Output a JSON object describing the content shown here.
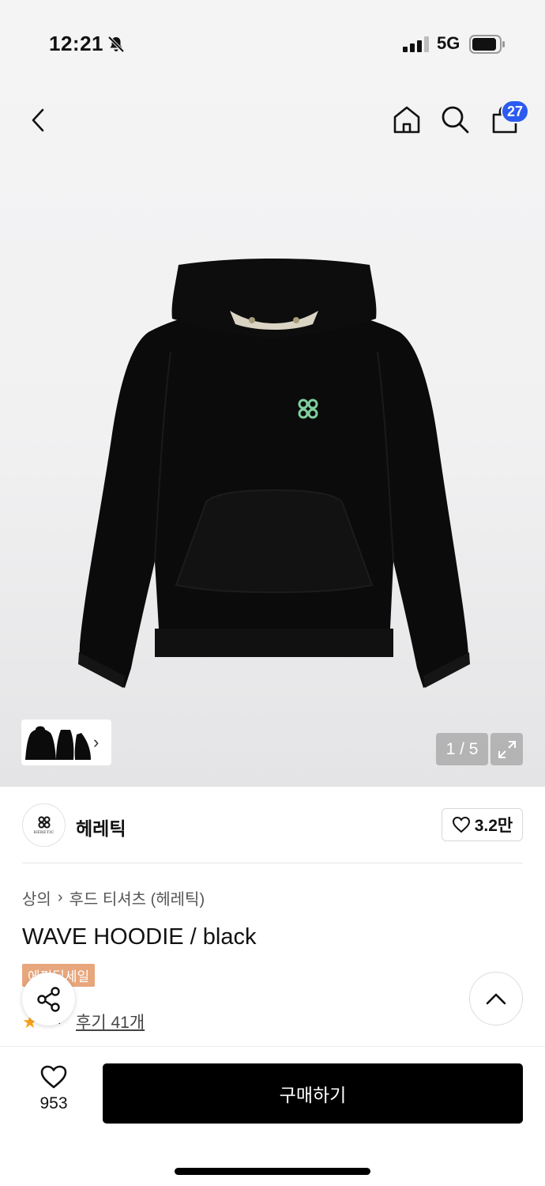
{
  "status_bar": {
    "time": "12:21",
    "network": "5G"
  },
  "nav": {
    "cart_count": "27"
  },
  "gallery": {
    "counter": "1 / 5"
  },
  "brand": {
    "name": "헤레틱",
    "logo_text": "HERETIC",
    "likes": "3.2만"
  },
  "product": {
    "breadcrumb": [
      "상의",
      "후드 티셔츠 (헤레틱)"
    ],
    "title": "WAVE HOODIE / black",
    "badge": "에픽딜세일",
    "rating": "4.7",
    "reviews": "후기 41개"
  },
  "bottom_bar": {
    "wish_count": "953",
    "buy_label": "구매하기"
  },
  "colors": {
    "accent_blue": "#2b5bf0",
    "sale_badge": "#e8a67c",
    "star": "#f7a21b",
    "buy_button": "#000000",
    "logo_green": "#7fcf9e"
  }
}
